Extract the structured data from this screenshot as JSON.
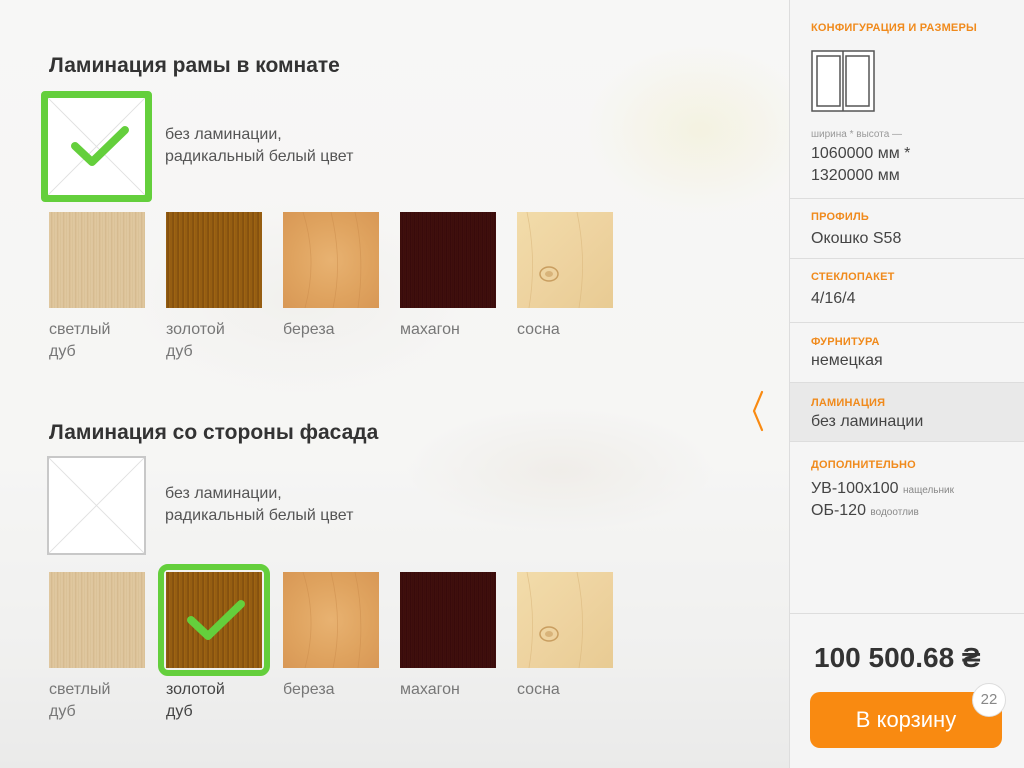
{
  "room_lamination": {
    "title": "Ламинация рамы в комнате",
    "none_label_line1": "без ламинации,",
    "none_label_line2": "радикальный белый цвет",
    "selected": "none",
    "swatches": [
      {
        "id": "light_oak",
        "line1": "светлый",
        "line2": "дуб"
      },
      {
        "id": "golden_oak",
        "line1": "золотой",
        "line2": "дуб"
      },
      {
        "id": "birch",
        "line1": "береза",
        "line2": ""
      },
      {
        "id": "mahogany",
        "line1": "махагон",
        "line2": ""
      },
      {
        "id": "pine",
        "line1": "сосна",
        "line2": ""
      }
    ]
  },
  "facade_lamination": {
    "title": "Ламинация со стороны фасада",
    "none_label_line1": "без ламинации,",
    "none_label_line2": "радикальный белый цвет",
    "selected": "golden_oak",
    "swatches": [
      {
        "id": "light_oak",
        "line1": "светлый",
        "line2": "дуб"
      },
      {
        "id": "golden_oak",
        "line1": "золотой",
        "line2": "дуб"
      },
      {
        "id": "birch",
        "line1": "береза",
        "line2": ""
      },
      {
        "id": "mahogany",
        "line1": "махагон",
        "line2": ""
      },
      {
        "id": "pine",
        "line1": "сосна",
        "line2": ""
      }
    ]
  },
  "sidebar": {
    "config": {
      "heading": "КОНФИГУРАЦИЯ И РАЗМЕРЫ",
      "hint": "ширина * высота —",
      "size_line1": "1060000 мм *",
      "size_line2": "1320000 мм"
    },
    "profile": {
      "heading": "ПРОФИЛЬ",
      "value": "Окошко S58"
    },
    "glass": {
      "heading": "СТЕКЛОПАКЕТ",
      "value": "4/16/4"
    },
    "hardware": {
      "heading": "ФУРНИТУРА",
      "value": "немецкая"
    },
    "lamination": {
      "heading": "ЛАМИНАЦИЯ",
      "value": "без ламинации"
    },
    "extra": {
      "heading": "ДОПОЛНИТЕЛЬНО",
      "item1": "УВ-100х100",
      "item1_note": "нащельник",
      "item2": "ОБ-120",
      "item2_note": "водоотлив"
    }
  },
  "price": "100 500.68 ₴",
  "cart": {
    "label": "В корзину",
    "count": "22"
  },
  "colors": {
    "accent": "#f98a11",
    "heading_orange": "#f08a1c",
    "selected_green": "#64cf3c"
  },
  "icons": {
    "check": "check-icon",
    "collapse": "chevron-left-icon",
    "window": "window-icon"
  }
}
